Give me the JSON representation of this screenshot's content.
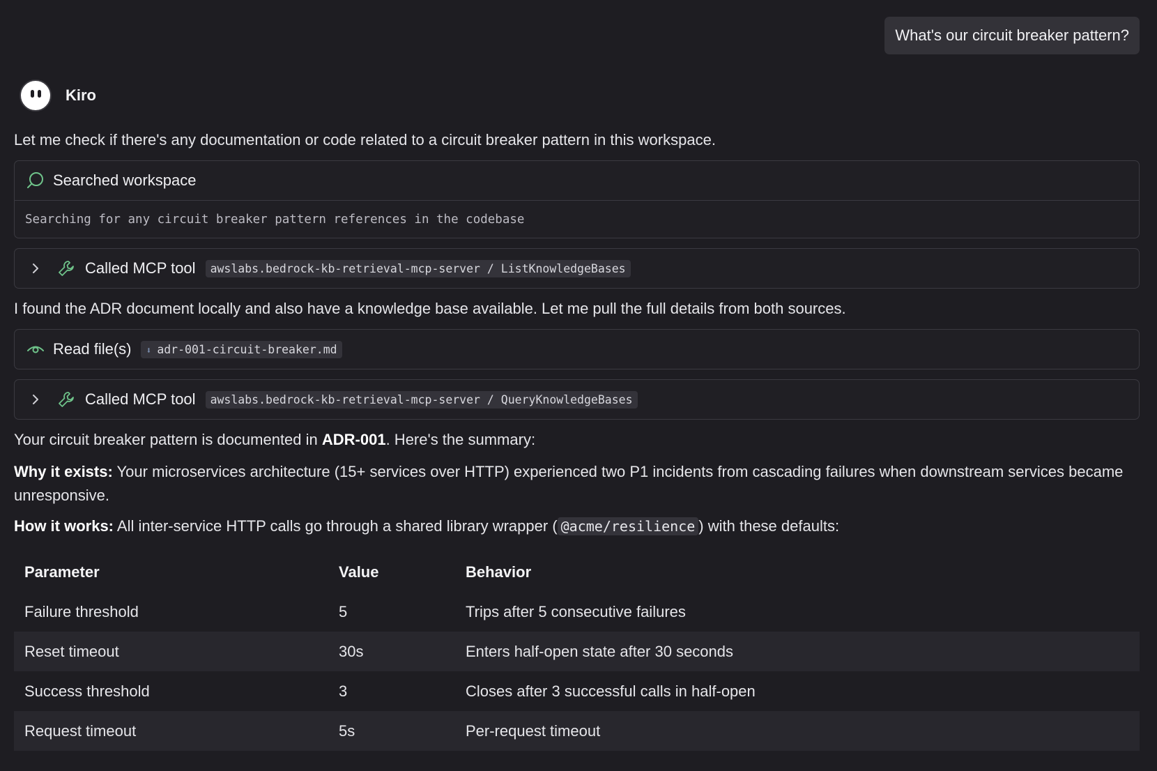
{
  "user_message": "What's our circuit breaker pattern?",
  "agent": {
    "name": "Kiro"
  },
  "intro": "Let me check if there's any documentation or code related to a circuit breaker pattern in this workspace.",
  "search_card": {
    "title": "Searched workspace",
    "detail": "Searching for any circuit breaker pattern references in the codebase"
  },
  "mcp_call_1": {
    "title": "Called MCP tool",
    "tool": "awslabs.bedrock-kb-retrieval-mcp-server / ListKnowledgeBases"
  },
  "found_text": "I found the ADR document locally and also have a knowledge base available. Let me pull the full details from both sources.",
  "read_card": {
    "title": "Read file(s)",
    "file": "adr-001-circuit-breaker.md"
  },
  "mcp_call_2": {
    "title": "Called MCP tool",
    "tool": "awslabs.bedrock-kb-retrieval-mcp-server / QueryKnowledgeBases"
  },
  "summary": {
    "lead_pre": "Your circuit breaker pattern is documented in ",
    "lead_bold": "ADR-001",
    "lead_post": ". Here's the summary:",
    "why_label": "Why it exists:",
    "why_text": " Your microservices architecture (15+ services over HTTP) experienced two P1 incidents from cascading failures when downstream services became unresponsive.",
    "how_label": "How it works:",
    "how_pre": " All inter-service HTTP calls go through a shared library wrapper (",
    "how_code": "@acme/resilience",
    "how_post": ") with these defaults:"
  },
  "table": {
    "headers": [
      "Parameter",
      "Value",
      "Behavior"
    ],
    "rows": [
      [
        "Failure threshold",
        "5",
        "Trips after 5 consecutive failures"
      ],
      [
        "Reset timeout",
        "30s",
        "Enters half-open state after 30 seconds"
      ],
      [
        "Success threshold",
        "3",
        "Closes after 3 successful calls in half-open"
      ],
      [
        "Request timeout",
        "5s",
        "Per-request timeout"
      ]
    ]
  },
  "colors": {
    "accent_green": "#6fc38a",
    "background": "#1e1d22"
  }
}
